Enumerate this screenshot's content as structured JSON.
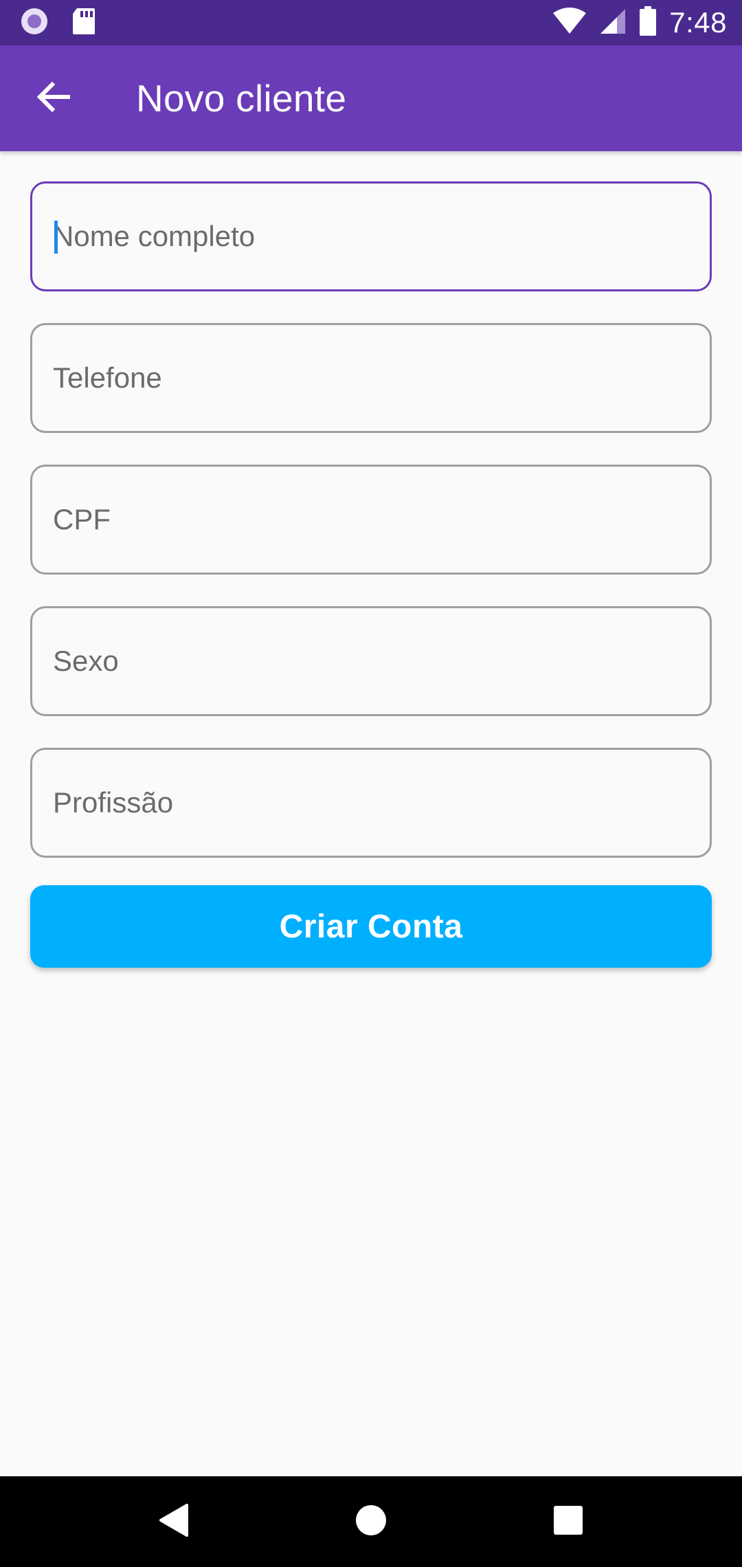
{
  "status_bar": {
    "time": "7:48",
    "icons": [
      "app-notification-icon",
      "sd-card-icon",
      "wifi-icon",
      "cellular-signal-icon",
      "battery-icon"
    ]
  },
  "app_bar": {
    "title": "Novo cliente",
    "back_icon": "arrow-back-icon",
    "color": "#6a3cb8"
  },
  "form": {
    "fields": [
      {
        "placeholder": "Nome completo",
        "value": "",
        "focused": true
      },
      {
        "placeholder": "Telefone",
        "value": ""
      },
      {
        "placeholder": "CPF",
        "value": ""
      },
      {
        "placeholder": "Sexo",
        "value": ""
      },
      {
        "placeholder": "Profissão",
        "value": ""
      }
    ],
    "submit_label": "Criar Conta",
    "submit_color": "#00b0ff"
  },
  "nav_bar": {
    "icons": [
      "nav-back-icon",
      "nav-home-icon",
      "nav-recents-icon"
    ]
  }
}
